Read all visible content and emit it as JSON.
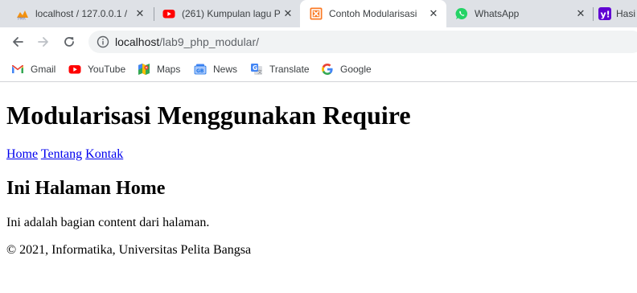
{
  "browser": {
    "tabs": [
      {
        "title": "localhost / 127.0.0.1 /",
        "icon": "phpmyadmin-icon",
        "active": false
      },
      {
        "title": "(261) Kumpulan lagu P",
        "icon": "youtube-icon",
        "active": false
      },
      {
        "title": "Contoh Modularisasi",
        "icon": "xampp-icon",
        "active": true
      },
      {
        "title": "WhatsApp",
        "icon": "whatsapp-icon",
        "active": false
      },
      {
        "title": "Hasi",
        "icon": "yahoo-icon",
        "active": false
      }
    ],
    "close_glyph": "✕",
    "address": {
      "host": "localhost",
      "path": "/lab9_php_modular/"
    },
    "bookmarks": [
      {
        "label": "Gmail",
        "icon": "gmail-icon"
      },
      {
        "label": "YouTube",
        "icon": "youtube-icon"
      },
      {
        "label": "Maps",
        "icon": "maps-icon"
      },
      {
        "label": "News",
        "icon": "news-icon"
      },
      {
        "label": "Translate",
        "icon": "translate-icon"
      },
      {
        "label": "Google",
        "icon": "google-icon"
      }
    ]
  },
  "page": {
    "heading": "Modularisasi Menggunakan Require",
    "nav": [
      "Home",
      "Tentang",
      "Kontak"
    ],
    "subheading": "Ini Halaman Home",
    "content": "Ini adalah bagian content dari halaman.",
    "footer": "© 2021, Informatika, Universitas Pelita Bangsa"
  },
  "colors": {
    "tabstrip_bg": "#dee1e6",
    "omnibox_bg": "#f1f3f4",
    "link": "#0000ee"
  }
}
